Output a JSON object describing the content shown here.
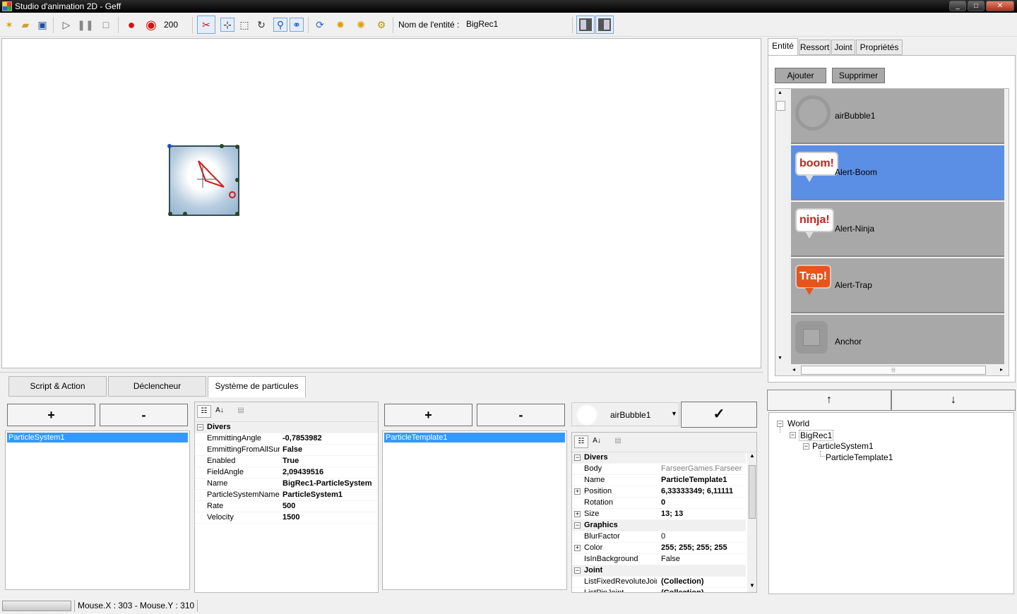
{
  "window": {
    "title": "Studio d'animation 2D - Geff",
    "controls": [
      "_",
      "□",
      "✕"
    ]
  },
  "toolbar": {
    "speed_value": "200",
    "entity_name_label": "Nom de l'entité :",
    "entity_name_value": "BigRec1"
  },
  "bottom_tabs": [
    {
      "label": "Script & Action"
    },
    {
      "label": "Déclencheur"
    },
    {
      "label": "Système de particules"
    }
  ],
  "particle_systems": {
    "add_label": "+",
    "remove_label": "-",
    "items": [
      "ParticleSystem1"
    ]
  },
  "psys_props": {
    "category": "Divers",
    "rows": [
      {
        "key": "EmmittingAngle",
        "value": "-0,7853982"
      },
      {
        "key": "EmmittingFromAllSurfa",
        "value": "False"
      },
      {
        "key": "Enabled",
        "value": "True"
      },
      {
        "key": "FieldAngle",
        "value": "2,09439516"
      },
      {
        "key": "Name",
        "value": "BigRec1-ParticleSystem"
      },
      {
        "key": "ParticleSystemName",
        "value": "ParticleSystem1"
      },
      {
        "key": "Rate",
        "value": "500"
      },
      {
        "key": "Velocity",
        "value": "1500"
      }
    ]
  },
  "templates": {
    "add_label": "+",
    "remove_label": "-",
    "items": [
      "ParticleTemplate1"
    ]
  },
  "template_picker": {
    "selected": "airBubble1",
    "confirm_label": "✓"
  },
  "tmpl_props": {
    "rows": [
      {
        "type": "cat",
        "key": "Divers"
      },
      {
        "key": "Body",
        "value": "FarseerGames.Farseer",
        "gray": true
      },
      {
        "key": "Name",
        "value": "ParticleTemplate1",
        "bold": true
      },
      {
        "key": "Position",
        "value": "6,33333349; 6,11111",
        "bold": true,
        "exp": true
      },
      {
        "key": "Rotation",
        "value": "0",
        "bold": true
      },
      {
        "key": "Size",
        "value": "13; 13",
        "bold": true,
        "exp": true
      },
      {
        "type": "cat",
        "key": "Graphics"
      },
      {
        "key": "BlurFactor",
        "value": "0"
      },
      {
        "key": "Color",
        "value": "255; 255; 255; 255",
        "bold": true,
        "exp": true
      },
      {
        "key": "IsInBackground",
        "value": "False"
      },
      {
        "type": "cat",
        "key": "Joint"
      },
      {
        "key": "ListFixedRevoluteJoin",
        "value": "(Collection)",
        "bold": true
      },
      {
        "key": "ListPinJoint",
        "value": "(Collection)",
        "bold": true
      }
    ]
  },
  "right_tabs": [
    {
      "label": "Entité"
    },
    {
      "label": "Ressort"
    },
    {
      "label": "Joint"
    },
    {
      "label": "Propriétés"
    }
  ],
  "entity_panel": {
    "add_label": "Ajouter",
    "remove_label": "Supprimer"
  },
  "entities": [
    {
      "name": "airBubble1",
      "icon": "bubble-icon"
    },
    {
      "name": "Alert-Boom",
      "icon": "boom-icon",
      "badge": "boom!"
    },
    {
      "name": "Alert-Ninja",
      "icon": "ninja-icon",
      "badge": "ninja!"
    },
    {
      "name": "Alert-Trap",
      "icon": "trap-icon",
      "badge": "Trap!"
    },
    {
      "name": "Anchor",
      "icon": "anchor-icon"
    }
  ],
  "order_buttons": {
    "up": "↑",
    "down": "↓"
  },
  "tree": {
    "root": "World",
    "child": "BigRec1",
    "grandchild": "ParticleSystem1",
    "leaf": "ParticleTemplate1"
  },
  "status": {
    "mouse": "Mouse.X : 303 - Mouse.Y : 310"
  },
  "colors": {
    "selection": "#3399ff",
    "entity_selected": "#5b8fe6",
    "entity_bg": "#a8a8a8"
  }
}
